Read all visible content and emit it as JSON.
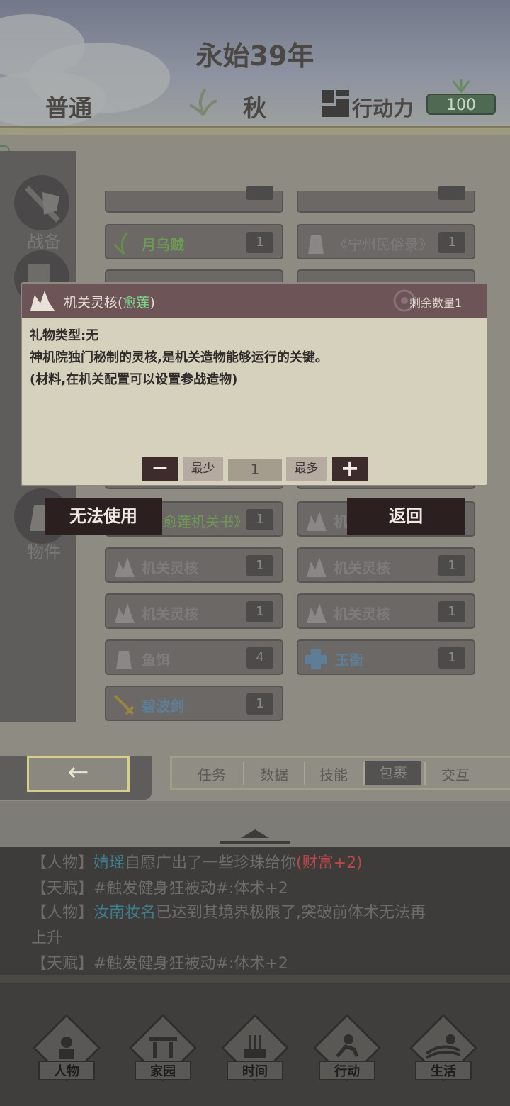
{
  "header": {
    "year": "永始39年",
    "mode": "普通",
    "season": "秋",
    "action_label": "行动力",
    "action_value": "100"
  },
  "sidebar": {
    "items": [
      {
        "label": "战备",
        "icon": "sword-shield-icon"
      },
      {
        "label": "物件",
        "icon": "bag-icon"
      }
    ]
  },
  "inventory": {
    "rows": [
      {
        "left": {
          "name": "月乌贼",
          "count": "1",
          "icon": "herb-icon"
        },
        "right": {
          "name": "《宁州民俗录》",
          "count": "1",
          "icon": "bag-icon"
        }
      },
      {
        "left": {
          "name": "《愈莲机关书》",
          "count": "1",
          "icon": "book-icon"
        },
        "right": {
          "name": "机",
          "count": "1",
          "icon": "mech-core-icon"
        }
      },
      {
        "left": {
          "name": "机关灵核",
          "count": "1",
          "icon": "mech-core-icon"
        },
        "right": {
          "name": "机关灵核",
          "count": "1",
          "icon": "mech-core-icon"
        }
      },
      {
        "left": {
          "name": "机关灵核",
          "count": "1",
          "icon": "mech-core-icon"
        },
        "right": {
          "name": "机关灵核",
          "count": "1",
          "icon": "mech-core-icon"
        }
      },
      {
        "left": {
          "name": "鱼饵",
          "count": "4",
          "icon": "bag-icon"
        },
        "right": {
          "name": "玉衡",
          "count": "1",
          "icon": "jade-icon"
        }
      },
      {
        "left": {
          "name": "碧波剑",
          "count": "1",
          "icon": "sword-icon"
        }
      }
    ]
  },
  "tabs": [
    "任务",
    "数据",
    "技能",
    "包裹",
    "交互"
  ],
  "selected_tab": "包裹",
  "back_arrow": "←",
  "dialog": {
    "title_prefix": "机关灵核(",
    "title_highlight": "愈莲",
    "title_suffix": ")",
    "remaining": "剩余数量1",
    "desc_line1": "礼物类型:无",
    "desc_line2": "神机院独门秘制的灵核,是机关造物能够运行的关键。",
    "desc_line3": "(材料,在机关配置可以设置参战造物)",
    "minus": "−",
    "min_label": "最少",
    "quantity": "1",
    "max_label": "最多",
    "plus": "+",
    "unusable_button": "无法使用",
    "return_button": "返回"
  },
  "log": {
    "line0_a": "【人物】",
    "line0_b": "婧瑶",
    "line0_c": "自愿广出了一些珍珠给你",
    "line0_d": "(财富+2)",
    "line1": "【天赋】#触发健身狂被动#:体术+2",
    "line2_a": "【人物】",
    "line2_b": "汝南妆名",
    "line2_c": "已达到其境界极限了,突破前体术无法再",
    "line3": "上升",
    "line4": "【天赋】#触发健身狂被动#:体术+2"
  },
  "nav": [
    "人物",
    "家园",
    "时间",
    "行动",
    "生活"
  ],
  "colors": {
    "highlight_green": "#7ddc8e",
    "dialog_title_bg": "#6d5456",
    "dialog_bg": "#d6d1bd",
    "button_dark": "#2b1f1f"
  }
}
